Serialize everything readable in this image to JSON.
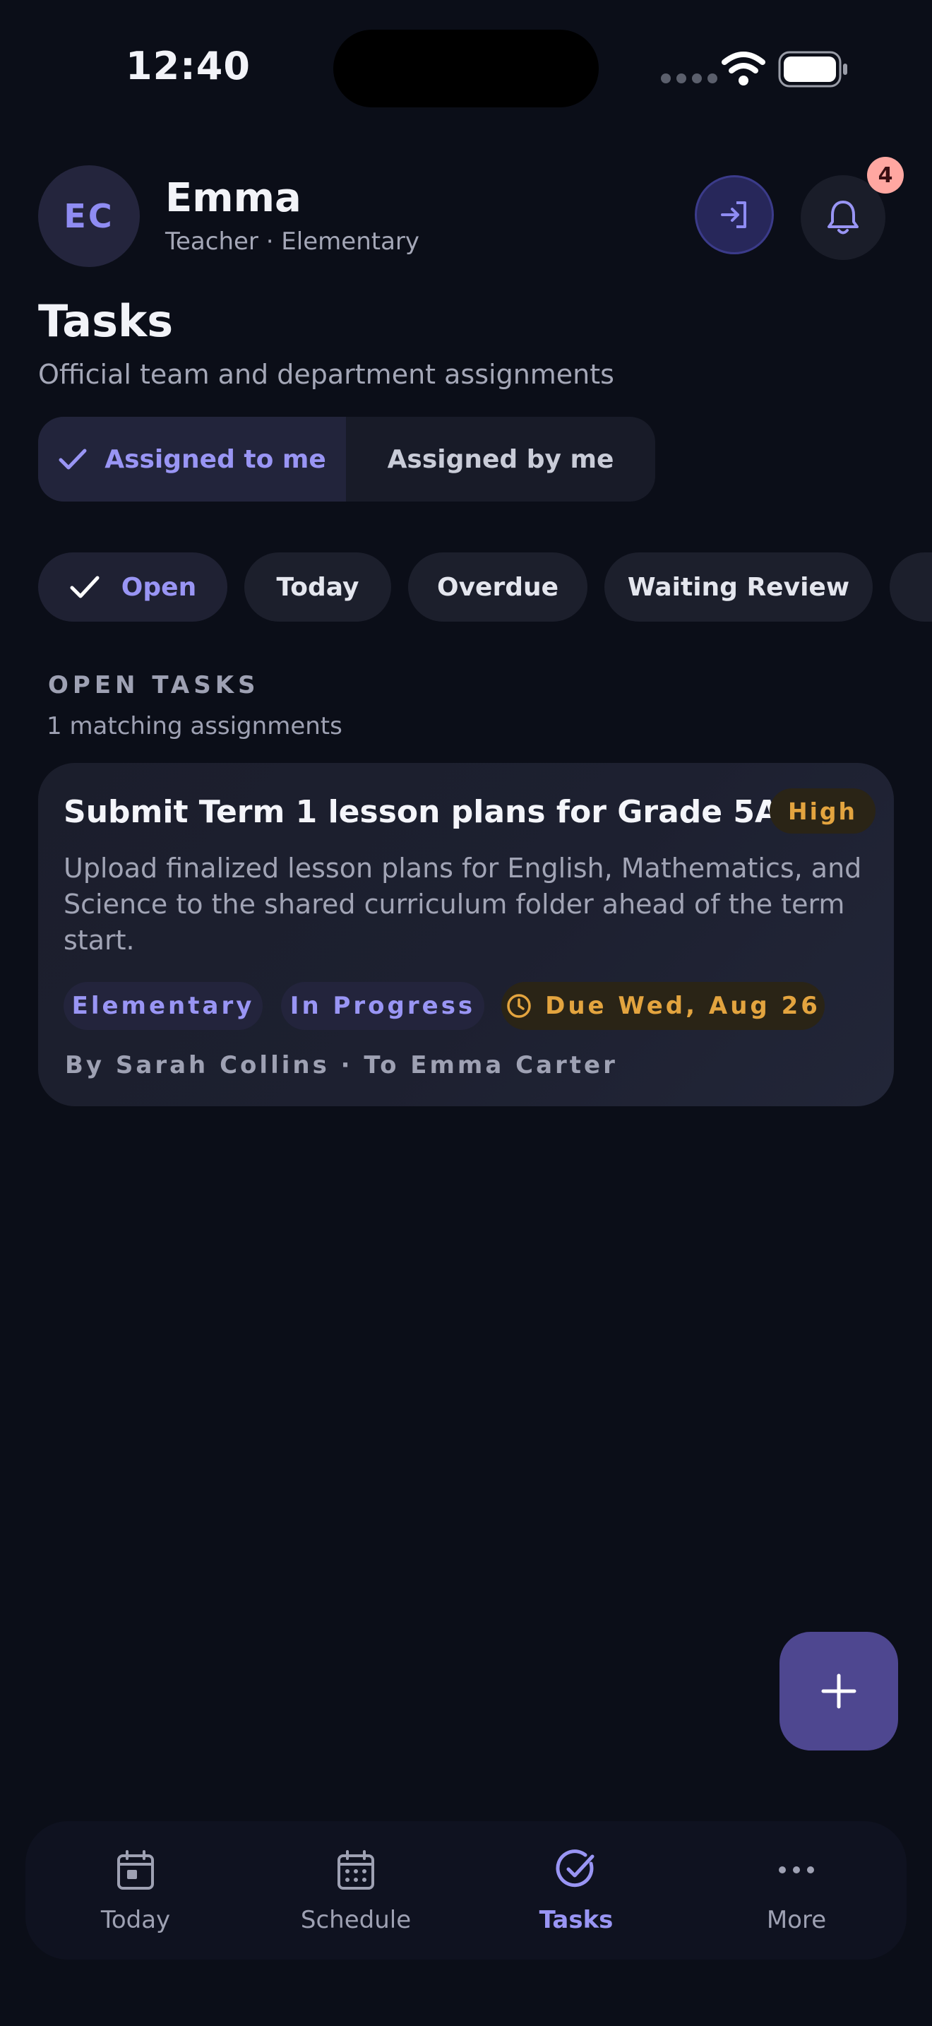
{
  "status_bar": {
    "time": "12:40"
  },
  "header": {
    "avatar_initials": "EC",
    "user_name": "Emma",
    "user_role": "Teacher · Elementary",
    "notification_count": "4"
  },
  "page": {
    "title": "Tasks",
    "subtitle": "Official team and department assignments"
  },
  "segment": {
    "assigned_to_me": "Assigned to me",
    "assigned_by_me": "Assigned by me"
  },
  "filters": {
    "open": "Open",
    "today": "Today",
    "overdue": "Overdue",
    "waiting_review": "Waiting Review"
  },
  "section": {
    "label": "OPEN TASKS",
    "count": "1 matching assignments"
  },
  "task": {
    "title": "Submit Term 1 lesson plans for Grade 5A",
    "priority": "High",
    "description": "Upload finalized lesson plans for English, Mathematics, and Science to the shared curriculum folder ahead of the term start.",
    "tag_department": "Elementary",
    "tag_status": "In Progress",
    "due": "Due Wed, Aug 26",
    "meta": "By Sarah Collins · To Emma Carter"
  },
  "nav": {
    "today": "Today",
    "schedule": "Schedule",
    "tasks": "Tasks",
    "more": "More"
  },
  "colors": {
    "background": "#0b0e18",
    "accent": "#9995f4",
    "priority_high": "#e3a43f",
    "badge": "#ffa7a1",
    "fab": "#4e4790"
  }
}
